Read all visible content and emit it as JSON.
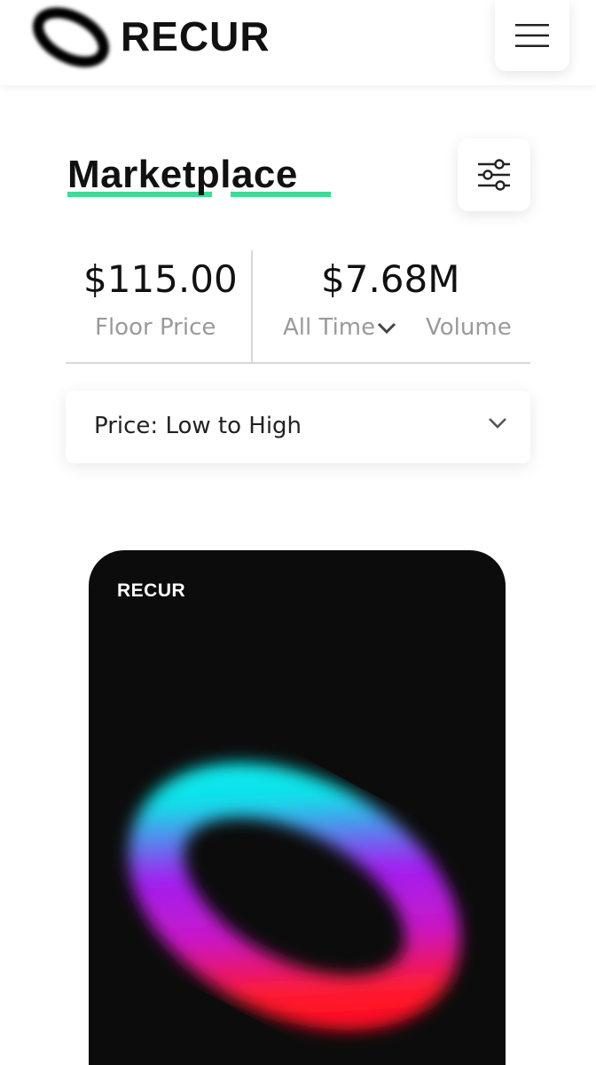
{
  "header": {
    "brand": "RECUR",
    "logo_icon": "ring-logo-icon",
    "menu_icon": "hamburger-menu-icon"
  },
  "page": {
    "title": "Marketplace",
    "filter_icon": "filter-sliders-icon",
    "accent_color": "#3ddc97"
  },
  "stats": {
    "floor_price": {
      "value": "$115.00",
      "label": "Floor Price"
    },
    "volume": {
      "value": "$7.68M",
      "period": "All Time",
      "label": "Volume"
    }
  },
  "sort": {
    "selected": "Price: Low to High",
    "icon": "chevron-down-icon"
  },
  "card": {
    "brand": "RECUR",
    "artwork": "gradient-ring-artwork",
    "colors": [
      "#00f0f0",
      "#a020f0",
      "#ff1030"
    ]
  }
}
